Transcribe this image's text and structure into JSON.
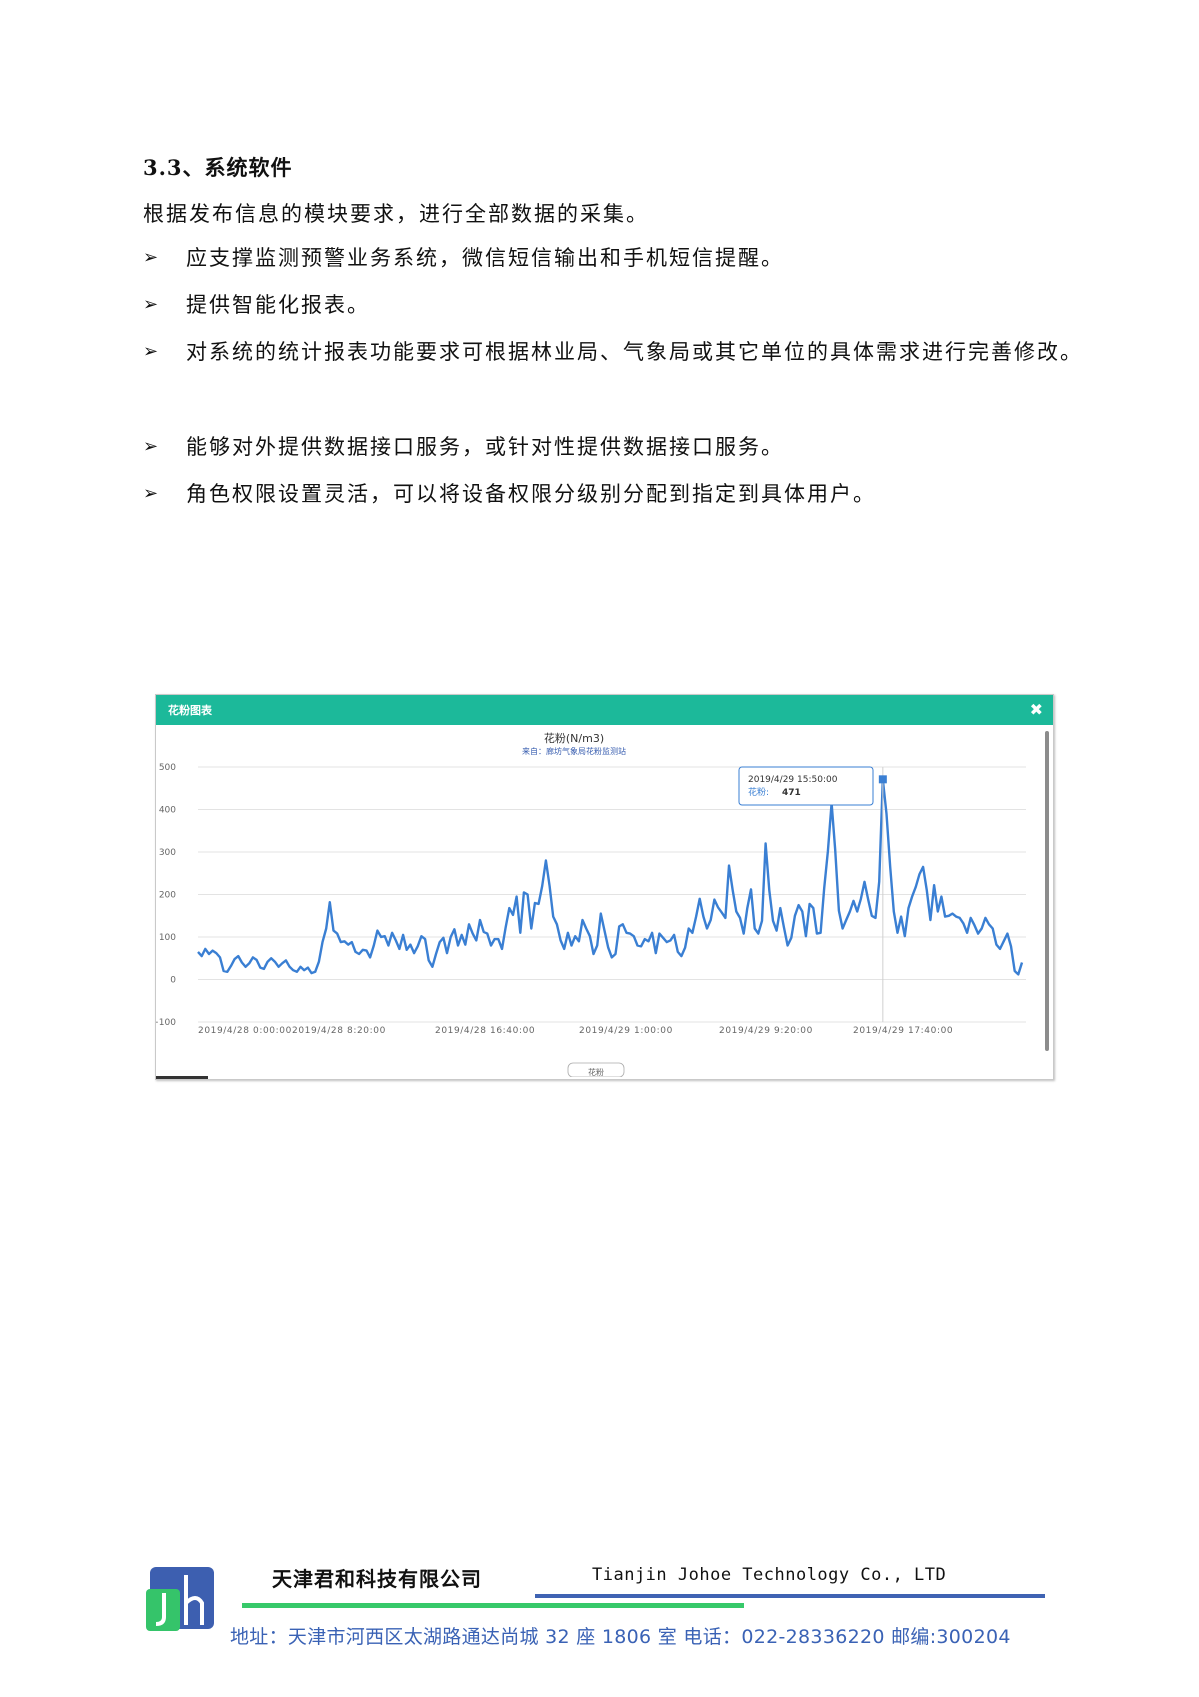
{
  "document": {
    "heading": "3.3、系统软件",
    "intro": "根据发布信息的模块要求，进行全部数据的采集。",
    "bullets": [
      "应支撑监测预警业务系统，微信短信输出和手机短信提醒。",
      "提供智能化报表。",
      "对系统的统计报表功能要求可根据林业局、气象局或其它单位的具体需求进行完善修改。",
      "能够对外提供数据接口服务，或针对性提供数据接口服务。",
      "角色权限设置灵活，可以将设备权限分级别分配到指定到具体用户。"
    ]
  },
  "chart_panel": {
    "header_title": "花粉图表",
    "close_symbol": "✖",
    "legend_label": "花粉"
  },
  "chart_data": {
    "type": "line",
    "title": "花粉(N/m3)",
    "subtitle": "来自：廊坊气象局花粉监测站",
    "ylim": [
      -100,
      500
    ],
    "yticks": [
      500,
      400,
      300,
      200,
      100,
      0,
      -100
    ],
    "xtick_labels": [
      "2019/4/28 0:00:00",
      "2019/4/28 8:20:00",
      "2019/4/28 16:40:00",
      "2019/4/29 1:00:00",
      "2019/4/29 9:20:00",
      "2019/4/29 17:40:00"
    ],
    "grid": true,
    "series_color": "#3a7fd3",
    "tooltip": {
      "time": "2019/4/29 15:50:00",
      "series_label": "花粉:",
      "value": "471"
    },
    "series": [
      {
        "name": "花粉",
        "values": [
          65,
          55,
          72,
          60,
          68,
          62,
          52,
          20,
          18,
          32,
          48,
          55,
          40,
          30,
          38,
          52,
          46,
          28,
          25,
          42,
          50,
          42,
          30,
          38,
          45,
          30,
          22,
          18,
          30,
          22,
          28,
          15,
          18,
          42,
          88,
          120,
          182,
          115,
          108,
          88,
          90,
          82,
          88,
          65,
          60,
          70,
          68,
          52,
          80,
          115,
          100,
          102,
          80,
          110,
          92,
          72,
          105,
          70,
          82,
          62,
          78,
          102,
          95,
          45,
          30,
          60,
          88,
          98,
          62,
          100,
          118,
          80,
          105,
          82,
          130,
          108,
          92,
          140,
          112,
          108,
          80,
          95,
          95,
          72,
          122,
          168,
          152,
          195,
          110,
          205,
          200,
          120,
          180,
          178,
          220,
          280,
          220,
          148,
          130,
          92,
          72,
          110,
          80,
          102,
          90,
          140,
          120,
          102,
          60,
          80,
          155,
          115,
          75,
          52,
          60,
          125,
          130,
          110,
          108,
          102,
          80,
          78,
          95,
          90,
          110,
          62,
          108,
          98,
          88,
          92,
          105,
          65,
          55,
          75,
          120,
          110,
          148,
          190,
          148,
          120,
          140,
          188,
          170,
          158,
          145,
          268,
          210,
          160,
          145,
          108,
          168,
          212,
          120,
          108,
          138,
          320,
          210,
          138,
          115,
          168,
          122,
          80,
          98,
          150,
          175,
          160,
          102,
          178,
          168,
          108,
          110,
          215,
          302,
          415,
          305,
          162,
          120,
          140,
          160,
          185,
          160,
          190,
          230,
          188,
          150,
          145,
          230,
          471,
          390,
          265,
          160,
          110,
          148,
          102,
          168,
          195,
          218,
          248,
          265,
          210,
          140,
          222,
          160,
          195,
          148,
          150,
          155,
          148,
          145,
          132,
          110,
          145,
          128,
          108,
          120,
          145,
          130,
          120,
          82,
          72,
          90,
          108,
          78,
          20,
          12,
          40
        ]
      }
    ]
  },
  "footer": {
    "company_cn": "天津君和科技有限公司",
    "company_en": "Tianjin Johoe Technology Co., LTD",
    "address": "地址：天津市河西区太湖路通达尚城 32 座 1806 室   电话：022-28336220  邮编:300204"
  }
}
